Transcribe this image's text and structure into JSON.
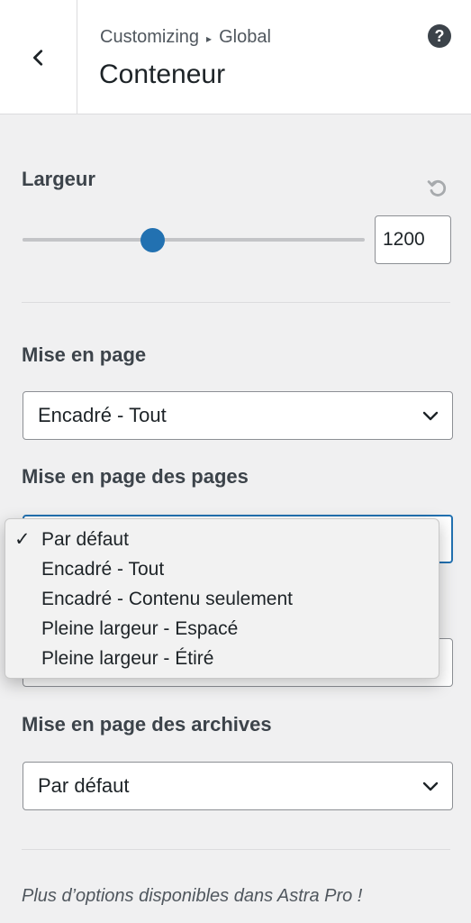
{
  "header": {
    "breadcrumb": [
      "Customizing",
      "Global"
    ],
    "breadcrumb_separator": "▸",
    "title": "Conteneur",
    "help": "?"
  },
  "largeur": {
    "label": "Largeur",
    "value": "1200",
    "slider_fraction": 0.38
  },
  "mise_en_page": {
    "label": "Mise en page",
    "selected": "Encadré - Tout"
  },
  "mise_en_page_pages": {
    "label": "Mise en page des pages",
    "options": [
      {
        "label": "Par défaut",
        "checked": true
      },
      {
        "label": "Encadré - Tout",
        "checked": false
      },
      {
        "label": "Encadré - Contenu seulement",
        "checked": false
      },
      {
        "label": "Pleine largeur - Espacé",
        "checked": false
      },
      {
        "label": "Pleine largeur - Étiré",
        "checked": false
      }
    ],
    "check_mark": "✓"
  },
  "mise_en_page_archives": {
    "label": "Mise en page des archives",
    "selected": "Par défaut"
  },
  "footer": {
    "note": "Plus d’options disponibles dans Astra Pro !"
  },
  "colors": {
    "accent": "#2271b1",
    "background": "#f0f0f1"
  }
}
